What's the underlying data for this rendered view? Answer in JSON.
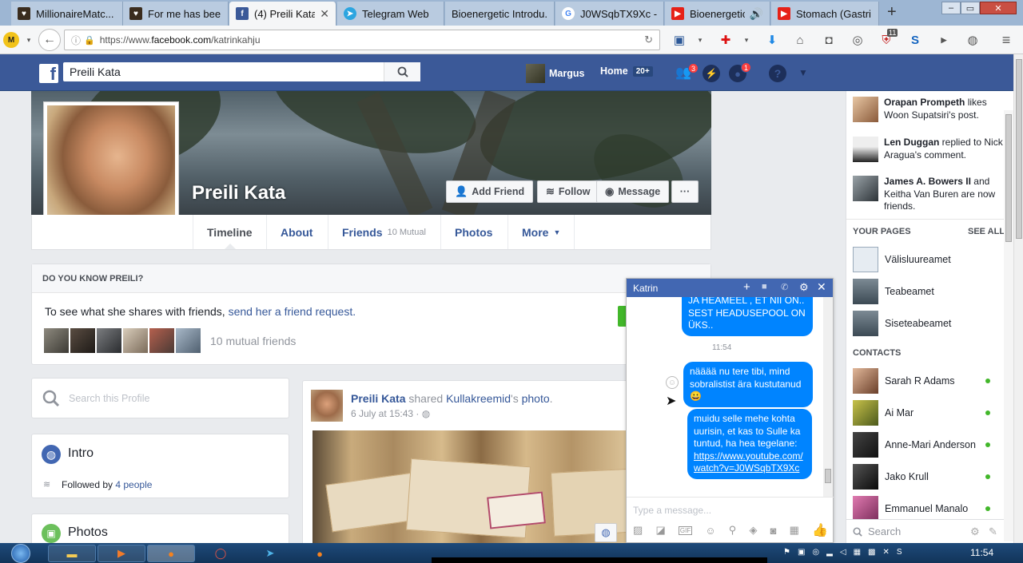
{
  "browser": {
    "tabs": [
      {
        "title": "MillionaireMatc...",
        "icon_color": "#3a2c1e",
        "icon": "heart-icon"
      },
      {
        "title": "For me has bee...",
        "icon_color": "#3a2c1e",
        "icon": "heart-icon"
      },
      {
        "title": "(4) Preili Kata",
        "icon_color": "#3b5998",
        "icon": "facebook-icon",
        "active": true
      },
      {
        "title": "Telegram Web",
        "icon_color": "#2ca5e0",
        "icon": "telegram-icon"
      },
      {
        "title": "Bioenergetic Introdu...",
        "icon_color": "",
        "icon": ""
      },
      {
        "title": "J0WSqbTX9Xc -...",
        "icon_color": "#4285f4",
        "icon": "google-icon"
      },
      {
        "title": "Bioenergetic...",
        "icon_color": "#e62117",
        "icon": "youtube-icon"
      },
      {
        "title": "Stomach (Gastri...",
        "icon_color": "#e62117",
        "icon": "youtube-icon"
      }
    ],
    "new_tab": "+",
    "url_prefix": "https://www.",
    "url_domain": "facebook.com",
    "url_path": "/katrinkahju",
    "toolbar_badge": "11"
  },
  "fb_header": {
    "search_value": "Preili Kata",
    "user_name": "Margus",
    "home_label": "Home",
    "home_count": "20+",
    "friend_requests_count": "3",
    "notifications_count": "1"
  },
  "profile": {
    "name": "Preili Kata",
    "add_friend": "Add Friend",
    "follow": "Follow",
    "message": "Message",
    "more_dots": "···",
    "tabs": {
      "timeline": "Timeline",
      "about": "About",
      "friends": "Friends",
      "friends_mutual": "10 Mutual",
      "photos": "Photos",
      "more": "More"
    }
  },
  "dyk": {
    "header": "DO YOU KNOW PREILI?",
    "text_prefix": "To see what she shares with friends,",
    "link": "send her a friend request.",
    "mutual_friends": "10 mutual friends"
  },
  "left_col": {
    "search_placeholder": "Search this Profile",
    "intro_title": "Intro",
    "followed_prefix": "Followed by",
    "followed_link": "4 people",
    "photos_title": "Photos"
  },
  "post": {
    "author": "Preili Kata",
    "shared": "shared",
    "page": "Kullakreemid",
    "possessive": "'s",
    "photo_link": "photo",
    "date": "6 July at 15:43 ·"
  },
  "chat": {
    "title": "Katrin",
    "msg_top": "JA HEAMEEL , ET NII ON.. SEST HEADUSEPOOL ON ÜKS..",
    "time": "11:54",
    "msg1": "nääää nu tere tibi, mind sobralistist ära kustutanud 😀",
    "msg2": "muidu selle mehe kohta uurisin, et kas to Sulle ka tuntud, ha hea tegelane:",
    "msg2_link": "https://www.youtube.com/watch?v=J0WSqbTX9Xc",
    "input_placeholder": "Type a message..."
  },
  "ticker": [
    {
      "name": "Orapan Prompeth",
      "text": "likes Woon Supatsiri's post."
    },
    {
      "name": "Len Duggan",
      "text": "replied to Nick Aragua's comment."
    },
    {
      "name": "James A. Bowers II",
      "text": "and Keitha Van Buren are now friends."
    }
  ],
  "your_pages": {
    "title": "YOUR PAGES",
    "see_all": "SEE ALL",
    "items": [
      "Välisluureamet",
      "Teabeamet",
      "Siseteabeamet"
    ]
  },
  "contacts": {
    "title": "CONTACTS",
    "items": [
      "Sarah R Adams",
      "Ai Mar",
      "Anne-Mari Anderson",
      "Jako Krull",
      "Emmanuel Manalo"
    ],
    "search_placeholder": "Search"
  },
  "taskbar": {
    "clock": "11:54"
  }
}
